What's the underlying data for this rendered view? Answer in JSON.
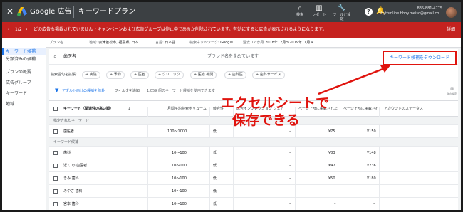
{
  "header": {
    "close": "✕",
    "brand": "Google 広告",
    "title": "キーワードプラン",
    "tools": [
      {
        "icon": "⌕",
        "label": "検索",
        "name": "search-icon"
      },
      {
        "icon": "▥",
        "label": "レポート",
        "name": "reports-icon"
      },
      {
        "icon": "🔧",
        "label": "ツールと設定",
        "name": "wrench-icon"
      }
    ],
    "help": "?",
    "bell": "🔔",
    "account_id": "835-881-4775",
    "account_email": "rhythmline.bboy.meiso@gmail.co..."
  },
  "alert": {
    "prev": "‹",
    "page": "1/2",
    "next": "›",
    "message": "どの広告も掲載されていません・キャンペーンおよび広告グループは停止中であるか削除されています。有効にすると広告が表示されるようになります。",
    "detail": "詳細"
  },
  "context": {
    "plan_label": "プラン名",
    "plan_value": "...",
    "region_label": "地域:",
    "region_value": "会津若松市, 福島県, 日本",
    "lang_label": "言語:",
    "lang_value": "日本語",
    "network_label": "検索ネットワーク:",
    "network_value": "Google",
    "period_label": "過去 12 か月",
    "period_value": "2018年12月～2019年11月",
    "period_arrow": "▾"
  },
  "sidebar": {
    "items": [
      {
        "label": "キーワード候補",
        "active": true
      },
      {
        "label": "分類済みの候補",
        "active": false
      },
      {
        "label": "プランの概要",
        "active": false
      },
      {
        "label": "広告グループ",
        "active": false
      },
      {
        "label": "キーワード",
        "active": false
      },
      {
        "label": "地域",
        "active": false
      }
    ]
  },
  "search": {
    "icon": "⌕",
    "value": "歯医者",
    "placeholder": "ブランド名を含めています",
    "download": "キーワード候補をダウンロード"
  },
  "expand": {
    "label": "検索語句を拡張:",
    "chips": [
      "+ 病院",
      "+ 予約",
      "+ 医者",
      "+ クリニック",
      "+ 医療 機関",
      "+ 歯科医",
      "+ 歯科サービス"
    ]
  },
  "filter": {
    "icon": "▼",
    "adult": "アダルト向けの候補を除外",
    "add": "フィルタを追加",
    "count": "1,059 個のキーワード候補を使用できます",
    "tools_icon": "▥",
    "date": "列 の 設定"
  },
  "table": {
    "col_keyword": "キーワード（関連性の高い順）",
    "sort_arrow": "↓",
    "col_volume": "月間平均検索ボリューム",
    "col_competition": "競合性",
    "col_impression": "広告インプレッション シェア",
    "col_bid_low": "ページ上部に掲載された入札単価（低額帯）",
    "col_bid_high": "ページ上部に掲載された入札単価（高額帯）",
    "col_status": "アカウントのステータス",
    "group_provided": "指定されたキーワード",
    "group_ideas": "キーワード候補",
    "rows_provided": [
      {
        "kw": "歯医者",
        "vol": "100～1000",
        "comp": "低",
        "imp": "–",
        "low": "¥75",
        "high": "¥150"
      }
    ],
    "rows_ideas": [
      {
        "kw": "歯科",
        "vol": "10～100",
        "comp": "低",
        "imp": "–",
        "low": "¥83",
        "high": "¥148"
      },
      {
        "kw": "近く の 歯医者",
        "vol": "10～100",
        "comp": "低",
        "imp": "–",
        "low": "¥47",
        "high": "¥236"
      },
      {
        "kw": "きみ 歯科",
        "vol": "10～100",
        "comp": "低",
        "imp": "–",
        "low": "¥50",
        "high": "¥180"
      },
      {
        "kw": "みやざ 歯科",
        "vol": "10～100",
        "comp": "低",
        "imp": "–",
        "low": "–",
        "high": "–"
      },
      {
        "kw": "宮本 歯科",
        "vol": "10～100",
        "comp": "低",
        "imp": "–",
        "low": "–",
        "high": "–"
      }
    ]
  },
  "annotation": {
    "line1": "エクセルシートで",
    "line2": "保存できる",
    "color": "#e0140e"
  }
}
